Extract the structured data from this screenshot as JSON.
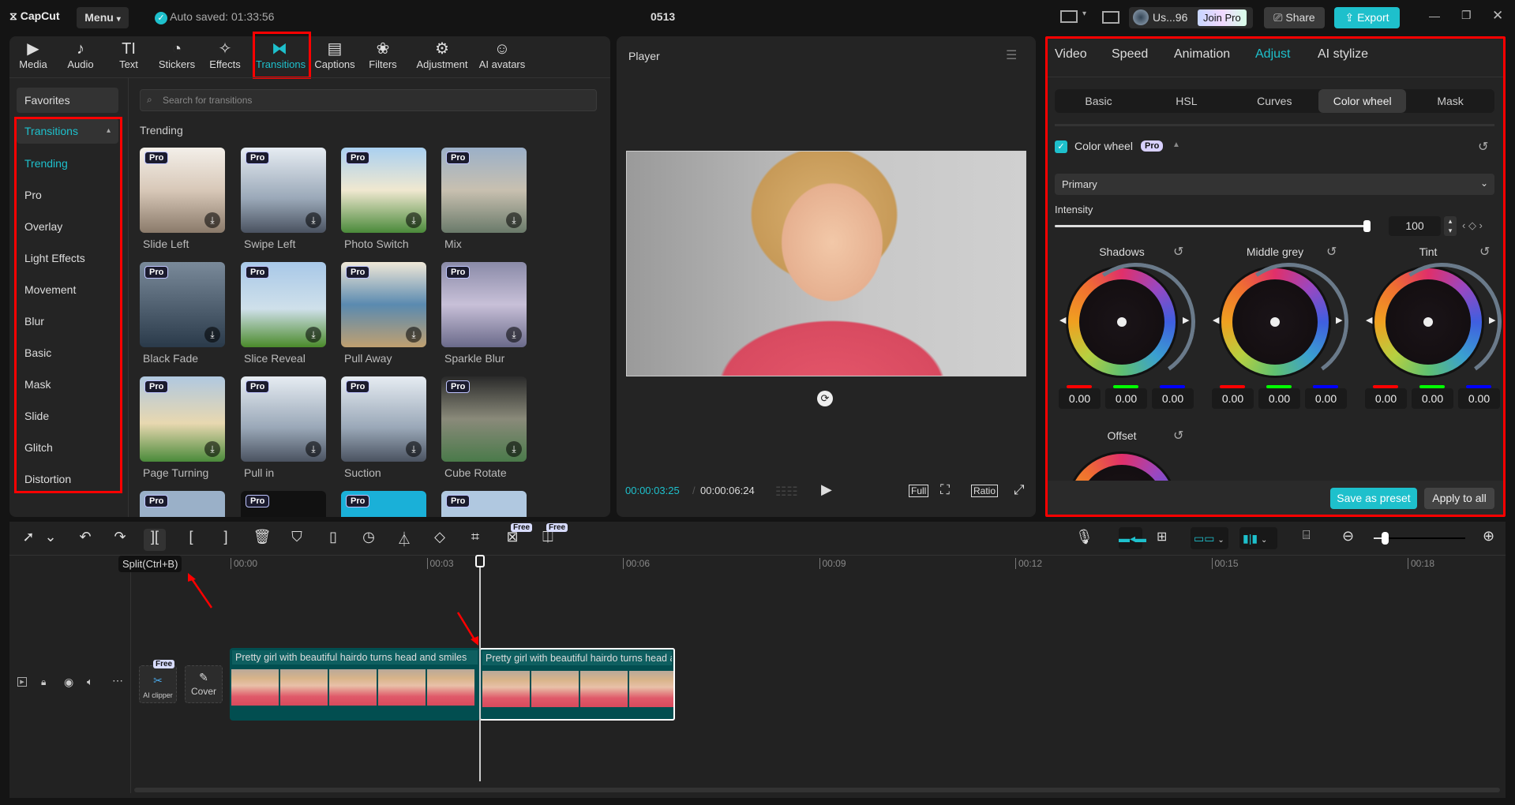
{
  "app": {
    "logo": "CapCut",
    "menu": "Menu",
    "autosave": "Auto saved: 01:33:56",
    "project_title": "0513",
    "user": "Us...96",
    "join_pro": "Join Pro",
    "share": "Share",
    "export": "Export"
  },
  "toolbar": [
    {
      "label": "Media",
      "icon": "▶"
    },
    {
      "label": "Audio",
      "icon": "♪"
    },
    {
      "label": "Text",
      "icon": "TI"
    },
    {
      "label": "Stickers",
      "icon": "◔"
    },
    {
      "label": "Effects",
      "icon": "✧"
    },
    {
      "label": "Transitions",
      "icon": "⧓"
    },
    {
      "label": "Captions",
      "icon": "▤"
    },
    {
      "label": "Filters",
      "icon": "❀"
    },
    {
      "label": "Adjustment",
      "icon": "⚙"
    },
    {
      "label": "AI avatars",
      "icon": "☺"
    }
  ],
  "categories": {
    "favorites": "Favorites",
    "group": "Transitions",
    "items": [
      "Trending",
      "Pro",
      "Overlay",
      "Light Effects",
      "Movement",
      "Blur",
      "Basic",
      "Mask",
      "Slide",
      "Glitch",
      "Distortion"
    ]
  },
  "search": {
    "placeholder": "Search for transitions"
  },
  "section": "Trending",
  "pro_badge": "Pro",
  "transitions": [
    "Slide Left",
    "Swipe Left",
    "Photo Switch",
    "Mix",
    "Black Fade",
    "Slice Reveal",
    "Pull Away",
    "Sparkle Blur",
    "Page Turning",
    "Pull in",
    "Suction",
    "Cube Rotate"
  ],
  "player": {
    "title": "Player",
    "current": "00:00:03:25",
    "sep": "/",
    "total": "00:00:06:24",
    "full": "Full",
    "ratio": "Ratio"
  },
  "inspector": {
    "tabs": [
      "Video",
      "Speed",
      "Animation",
      "Adjust",
      "AI stylize"
    ],
    "active_tab": "Adjust",
    "subtabs": [
      "Basic",
      "HSL",
      "Curves",
      "Color wheel",
      "Mask"
    ],
    "active_subtab": "Color wheel",
    "section": "Color wheel",
    "section_checked": true,
    "pro": "Pro",
    "mode": "Primary",
    "intensity_label": "Intensity",
    "intensity": "100",
    "wheels": [
      {
        "name": "Shadows",
        "r": "0.00",
        "g": "0.00",
        "b": "0.00"
      },
      {
        "name": "Middle grey",
        "r": "0.00",
        "g": "0.00",
        "b": "0.00"
      },
      {
        "name": "Tint",
        "r": "0.00",
        "g": "0.00",
        "b": "0.00"
      },
      {
        "name": "Offset"
      }
    ],
    "save_preset": "Save as preset",
    "apply_all": "Apply to all"
  },
  "timeline": {
    "free": "Free",
    "tooltip": "Split(Ctrl+B)",
    "ruler": [
      "00:00",
      "00:03",
      "00:06",
      "00:09",
      "00:12",
      "00:15",
      "00:18"
    ],
    "ai_clipper": "AI clipper",
    "cover": "Cover",
    "clips": [
      "Pretty girl with beautiful hairdo turns head and smiles",
      "Pretty girl with beautiful hairdo turns head and smiles"
    ],
    "zoom_level": 0.12
  },
  "colors": {
    "accent": "#1ec0cc",
    "highlight": "#ff0000"
  }
}
